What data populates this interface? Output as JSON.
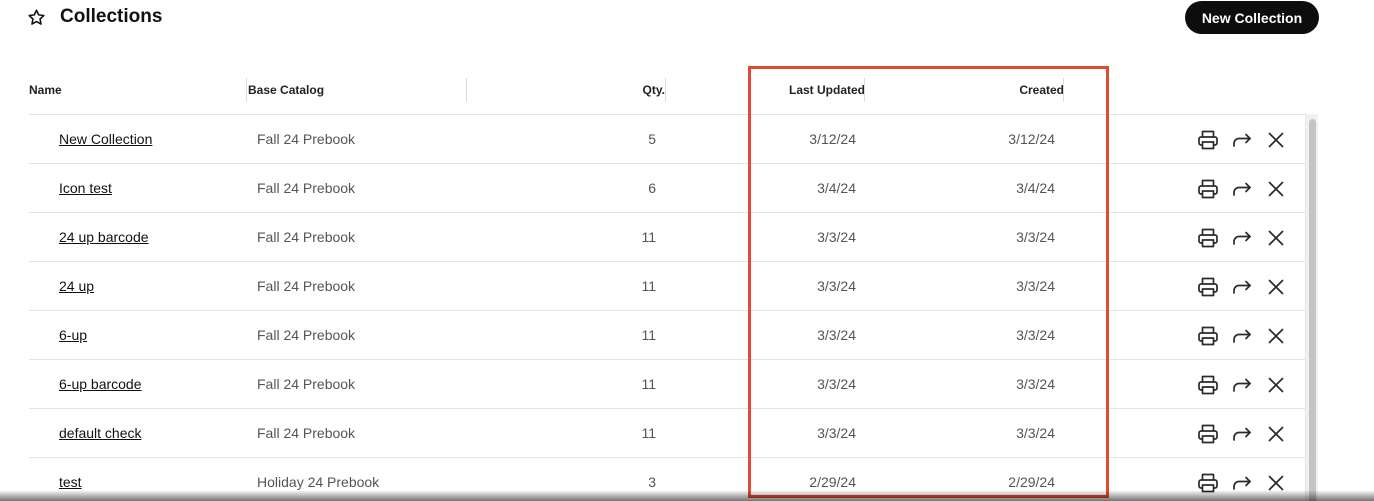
{
  "header": {
    "icon": "star-icon",
    "title": "Collections",
    "new_button_label": "New Collection"
  },
  "table": {
    "columns": {
      "name": "Name",
      "base_catalog": "Base Catalog",
      "qty": "Qty.",
      "last_updated": "Last Updated",
      "created": "Created"
    },
    "row_actions": [
      "printer-icon",
      "share-arrow-icon",
      "close-icon"
    ],
    "rows": [
      {
        "name": "New Collection",
        "base_catalog": "Fall 24 Prebook",
        "qty": "5",
        "last_updated": "3/12/24",
        "created": "3/12/24"
      },
      {
        "name": "Icon test",
        "base_catalog": "Fall 24 Prebook",
        "qty": "6",
        "last_updated": "3/4/24",
        "created": "3/4/24"
      },
      {
        "name": "24 up barcode",
        "base_catalog": "Fall 24 Prebook",
        "qty": "11",
        "last_updated": "3/3/24",
        "created": "3/3/24"
      },
      {
        "name": "24 up",
        "base_catalog": "Fall 24 Prebook",
        "qty": "11",
        "last_updated": "3/3/24",
        "created": "3/3/24"
      },
      {
        "name": "6-up",
        "base_catalog": "Fall 24 Prebook",
        "qty": "11",
        "last_updated": "3/3/24",
        "created": "3/3/24"
      },
      {
        "name": "6-up barcode",
        "base_catalog": "Fall 24 Prebook",
        "qty": "11",
        "last_updated": "3/3/24",
        "created": "3/3/24"
      },
      {
        "name": "default check",
        "base_catalog": "Fall 24 Prebook",
        "qty": "11",
        "last_updated": "3/3/24",
        "created": "3/3/24"
      },
      {
        "name": "test",
        "base_catalog": "Holiday 24 Prebook",
        "qty": "3",
        "last_updated": "2/29/24",
        "created": "2/29/24"
      }
    ]
  },
  "colors": {
    "button_bg": "#0d0d0d",
    "highlight_border": "#e24a35"
  }
}
